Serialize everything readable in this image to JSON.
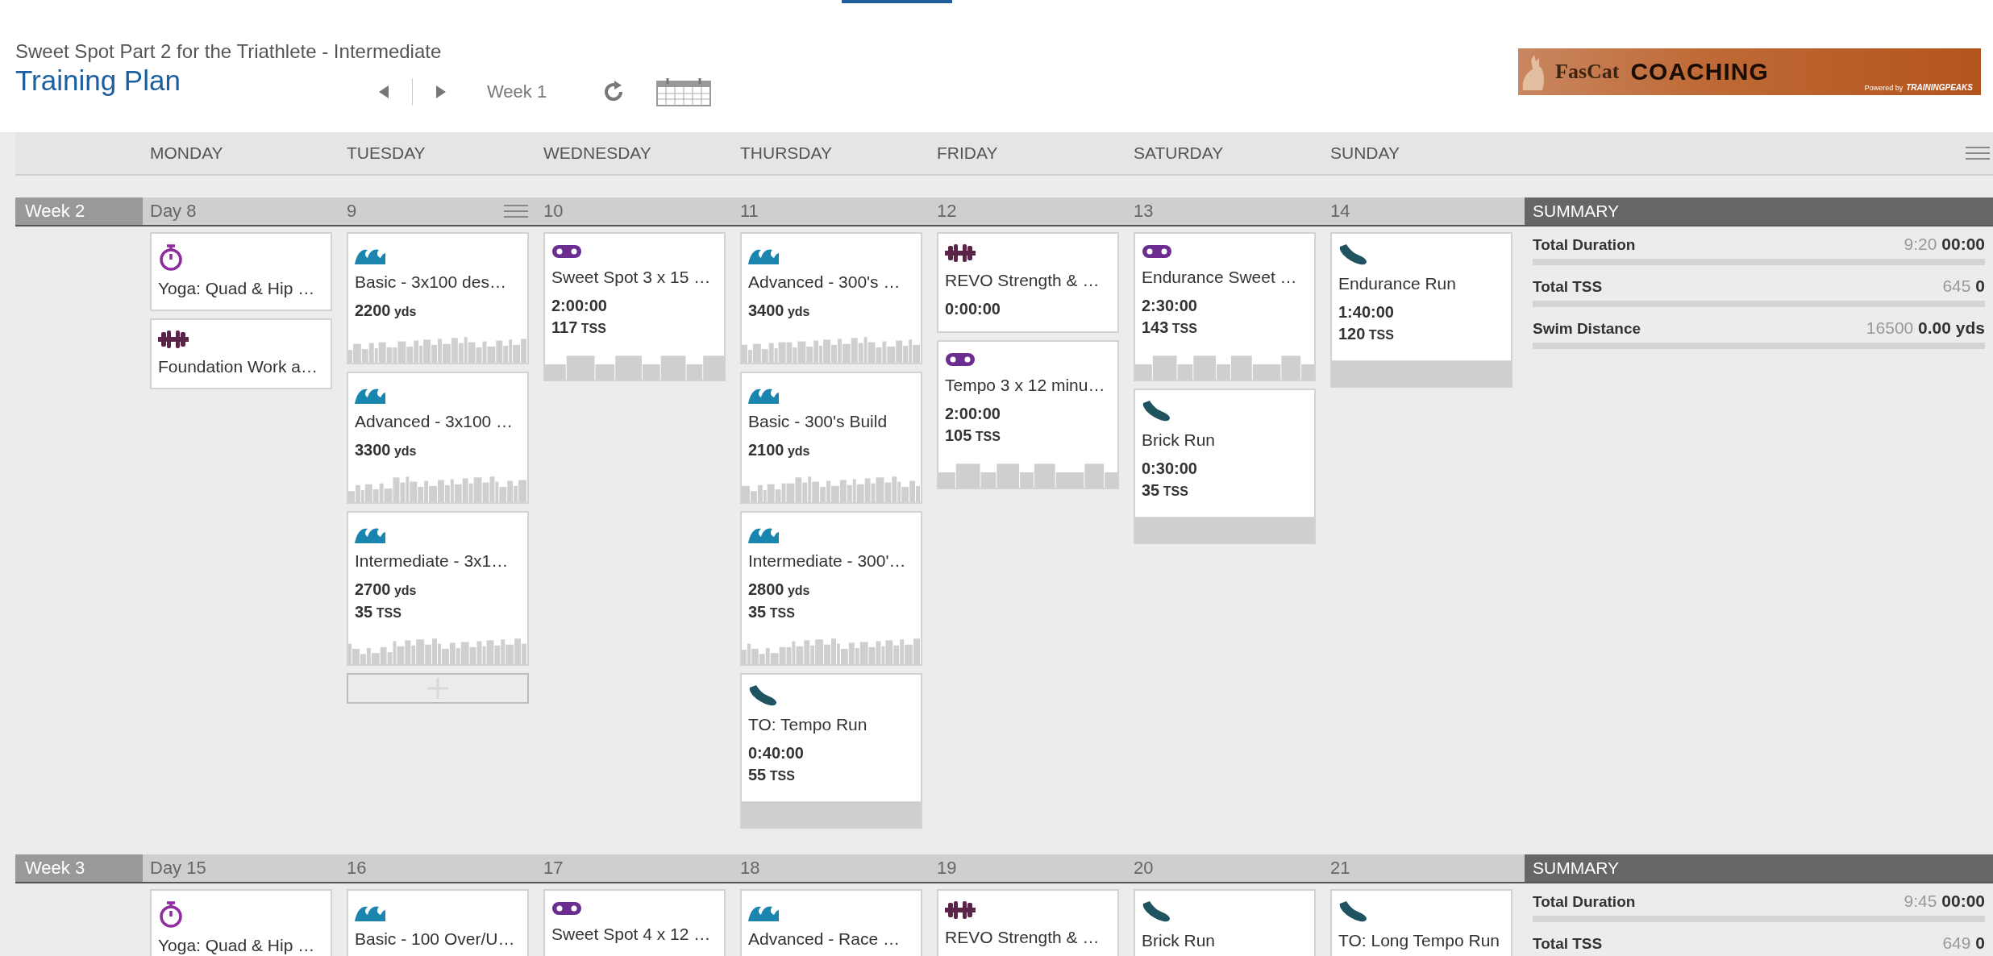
{
  "header": {
    "subtitle": "Sweet Spot Part 2 for the Triathlete - Intermediate",
    "title": "Training Plan",
    "week": "Week 1"
  },
  "logo": {
    "brand": "FasCat",
    "name": "COACHING",
    "powered_by": "Powered by",
    "partner": "TRAININGPEAKS"
  },
  "weekdays": [
    "MONDAY",
    "TUESDAY",
    "WEDNESDAY",
    "THURSDAY",
    "FRIDAY",
    "SATURDAY",
    "SUNDAY"
  ],
  "weeks": [
    {
      "label": "Week 2",
      "summary_title": "SUMMARY",
      "summary": [
        {
          "label": "Total Duration",
          "planned": "9:20",
          "completed": "00:00"
        },
        {
          "label": "Total TSS",
          "planned": "645",
          "completed": "0"
        },
        {
          "label": "Swim Distance",
          "planned": "16500",
          "completed": "0.00 yds"
        }
      ],
      "days": [
        {
          "number": "Day 8",
          "workouts": [
            {
              "kind": "yoga",
              "title": "Yoga: Quad & Hip …"
            },
            {
              "kind": "strength",
              "title": "Foundation Work a…"
            }
          ]
        },
        {
          "number": "9",
          "menu": true,
          "add_button": true,
          "workouts": [
            {
              "kind": "swim",
              "title": "Basic - 3x100 des…",
              "stats": [
                {
                  "value": "2200",
                  "unit": "yds"
                }
              ]
            },
            {
              "kind": "swim",
              "title": "Advanced - 3x100 …",
              "stats": [
                {
                  "value": "3300",
                  "unit": "yds"
                }
              ]
            },
            {
              "kind": "swim",
              "title": "Intermediate - 3x1…",
              "stats": [
                {
                  "value": "2700",
                  "unit": "yds"
                },
                {
                  "value": "35",
                  "unit": "TSS"
                }
              ]
            }
          ]
        },
        {
          "number": "10",
          "workouts": [
            {
              "kind": "bike",
              "title": "Sweet Spot 3 x 15 …",
              "stats": [
                {
                  "value": "2:00:00"
                },
                {
                  "value": "117",
                  "unit": "TSS"
                }
              ]
            }
          ]
        },
        {
          "number": "11",
          "workouts": [
            {
              "kind": "swim",
              "title": "Advanced - 300's …",
              "stats": [
                {
                  "value": "3400",
                  "unit": "yds"
                }
              ]
            },
            {
              "kind": "swim",
              "title": "Basic - 300's Build",
              "stats": [
                {
                  "value": "2100",
                  "unit": "yds"
                }
              ]
            },
            {
              "kind": "swim",
              "title": "Intermediate - 300'…",
              "stats": [
                {
                  "value": "2800",
                  "unit": "yds"
                },
                {
                  "value": "35",
                  "unit": "TSS"
                }
              ]
            },
            {
              "kind": "run",
              "title": "TO: Tempo Run",
              "stats": [
                {
                  "value": "0:40:00"
                },
                {
                  "value": "55",
                  "unit": "TSS"
                }
              ]
            }
          ]
        },
        {
          "number": "12",
          "workouts": [
            {
              "kind": "strength",
              "title": "REVO Strength & …",
              "stats": [
                {
                  "value": "0:00:00"
                }
              ]
            },
            {
              "kind": "bike",
              "title": "Tempo 3 x 12 minu…",
              "stats": [
                {
                  "value": "2:00:00"
                },
                {
                  "value": "105",
                  "unit": "TSS"
                }
              ]
            }
          ]
        },
        {
          "number": "13",
          "workouts": [
            {
              "kind": "bike",
              "title": "Endurance Sweet …",
              "stats": [
                {
                  "value": "2:30:00"
                },
                {
                  "value": "143",
                  "unit": "TSS"
                }
              ]
            },
            {
              "kind": "run",
              "title": "Brick Run",
              "stats": [
                {
                  "value": "0:30:00"
                },
                {
                  "value": "35",
                  "unit": "TSS"
                }
              ]
            }
          ]
        },
        {
          "number": "14",
          "workouts": [
            {
              "kind": "run",
              "title": "Endurance Run",
              "stats": [
                {
                  "value": "1:40:00"
                },
                {
                  "value": "120",
                  "unit": "TSS"
                }
              ]
            }
          ]
        }
      ]
    },
    {
      "label": "Week 3",
      "summary_title": "SUMMARY",
      "summary": [
        {
          "label": "Total Duration",
          "planned": "9:45",
          "completed": "00:00"
        },
        {
          "label": "Total TSS",
          "planned": "649",
          "completed": "0"
        }
      ],
      "days": [
        {
          "number": "Day 15",
          "workouts": [
            {
              "kind": "yoga",
              "title": "Yoga: Quad & Hip …"
            }
          ]
        },
        {
          "number": "16",
          "workouts": [
            {
              "kind": "swim",
              "title": "Basic - 100 Over/U…"
            }
          ]
        },
        {
          "number": "17",
          "workouts": [
            {
              "kind": "bike",
              "title": "Sweet Spot 4 x 12 …"
            }
          ]
        },
        {
          "number": "18",
          "workouts": [
            {
              "kind": "swim",
              "title": "Advanced - Race …"
            }
          ]
        },
        {
          "number": "19",
          "workouts": [
            {
              "kind": "strength",
              "title": "REVO Strength & …"
            }
          ]
        },
        {
          "number": "20",
          "workouts": [
            {
              "kind": "run",
              "title": "Brick Run"
            }
          ]
        },
        {
          "number": "21",
          "workouts": [
            {
              "kind": "run",
              "title": "TO: Long Tempo Run"
            }
          ]
        }
      ]
    }
  ]
}
